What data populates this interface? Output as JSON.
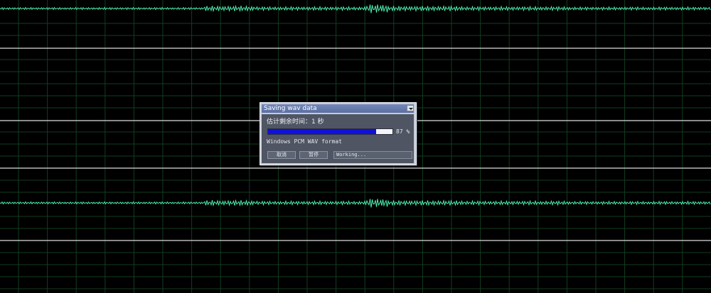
{
  "dialog": {
    "title": "Saving wav data",
    "time_label": "估计剩余时间：1 秒",
    "progress_percent": 87,
    "percent_text": "87 %",
    "format_text": "Windows PCM WAV format",
    "cancel_label": "取消",
    "pause_label": "暂停",
    "status_text": "Working..."
  },
  "colors": {
    "background": "#000000",
    "grid": "#123d1f",
    "divider": "#dcdcdc",
    "waveform": "#4ef0b0",
    "progress": "#1010dd",
    "dialog_body": "#4f5563"
  },
  "icons": {
    "dialog_menu": "chevron-down-icon"
  }
}
